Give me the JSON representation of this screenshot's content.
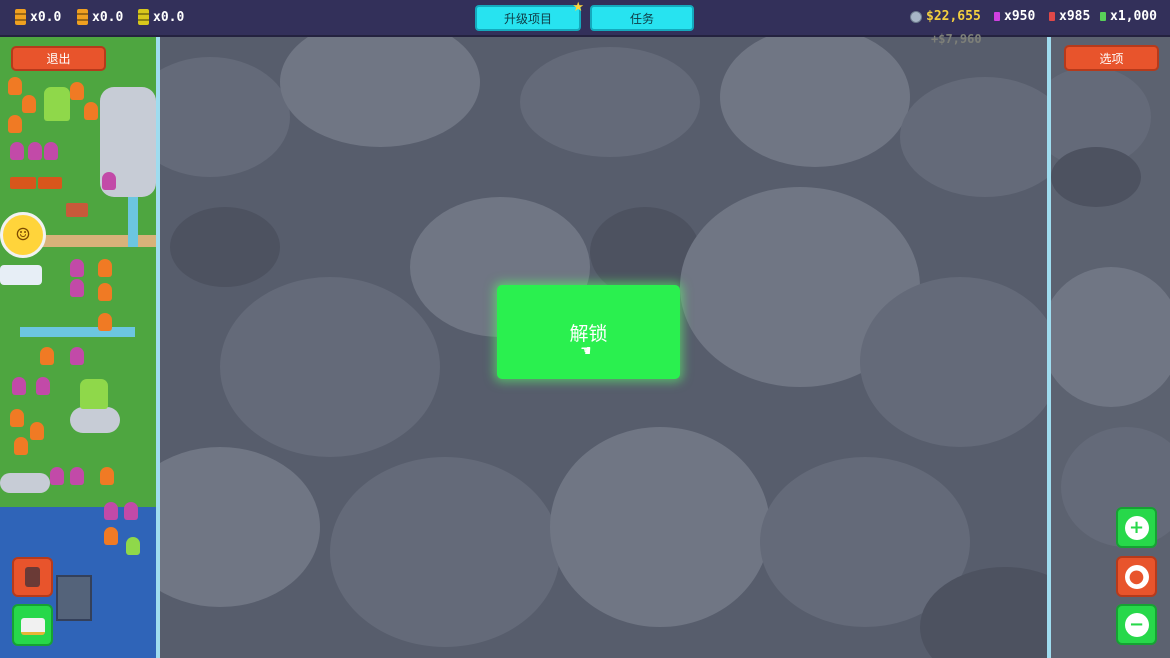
{
  "hud": {
    "resources": [
      {
        "icon": "orange-barrel-icon",
        "color": "#f0a020",
        "value": "x0.0"
      },
      {
        "icon": "orange-barrel-icon",
        "color": "#f0a020",
        "value": "x0.0"
      },
      {
        "icon": "yellow-barrel-icon",
        "color": "#d8c81c",
        "value": "x0.0"
      }
    ],
    "upgrade_button": "升级项目",
    "tasks_button": "任务",
    "money": "$22,655",
    "money_delta": "+$7,960",
    "gems": [
      {
        "icon": "purple-gem-icon",
        "color": "#d040e0",
        "value": "x950"
      },
      {
        "icon": "red-gem-icon",
        "color": "#e04848",
        "value": "x985"
      },
      {
        "icon": "green-gem-icon",
        "color": "#58d058",
        "value": "x1,000"
      }
    ]
  },
  "exit_button": "退出",
  "options_button": "选项",
  "unlock_button": "解锁",
  "colors": {
    "accent_cyan": "#27e3f0",
    "action_green": "#2af04f",
    "action_red": "#e8542c",
    "money_yellow": "#f4d03f"
  },
  "right_controls": [
    "plus-icon",
    "record-icon",
    "minus-icon"
  ],
  "left_controls": [
    "backpack-icon",
    "bus-icon"
  ]
}
